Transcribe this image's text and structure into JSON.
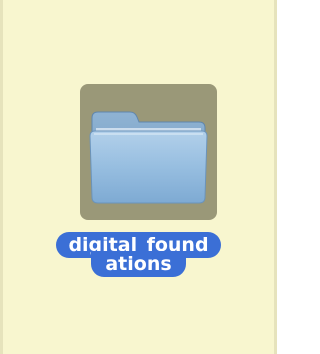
{
  "desktop": {
    "background_color": "#f8f6cf",
    "selection_color": "#3b6fd6"
  },
  "folder": {
    "icon": "folder-icon",
    "label_line1": "digital_found",
    "label_line2": "ations",
    "selected": true
  }
}
